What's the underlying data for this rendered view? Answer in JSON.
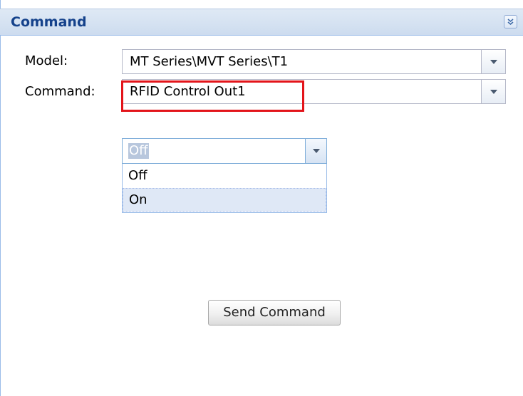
{
  "panel": {
    "title": "Command",
    "collapse_icon": "double-chevron-down-icon"
  },
  "form": {
    "model_label": "Model:",
    "model_value": "MT Series\\MVT Series\\T1",
    "command_label": "Command:",
    "command_value": "RFID Control Out1",
    "state_value": "Off",
    "state_options": [
      "Off",
      "On"
    ],
    "state_hovered_option": "On"
  },
  "actions": {
    "send_label": "Send Command"
  },
  "colors": {
    "header_text": "#15428b",
    "highlight_box": "#e3141a",
    "panel_border": "#99bbe8",
    "hovered_option_bg": "#dfe8f6"
  }
}
